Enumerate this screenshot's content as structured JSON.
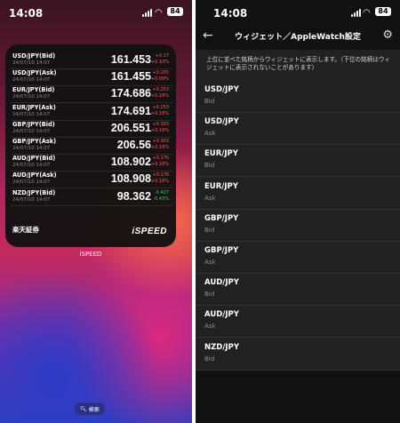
{
  "left_screen": {
    "status": {
      "time": "14:08",
      "battery": "84"
    },
    "widget": {
      "quotes": [
        {
          "pair": "USD/JPY(Bid)",
          "timestamp": "24/07/10 14:07",
          "price": "161.453",
          "change": "+0.17",
          "change_pct": "+0.10%",
          "direction": "up"
        },
        {
          "pair": "USD/JPY(Ask)",
          "timestamp": "24/07/10 14:07",
          "price": "161.455",
          "change": "+0.155",
          "change_pct": "+0.09%",
          "direction": "up"
        },
        {
          "pair": "EUR/JPY(Bid)",
          "timestamp": "24/07/10 14:07",
          "price": "174.686",
          "change": "+0.253",
          "change_pct": "+0.16%",
          "direction": "up"
        },
        {
          "pair": "EUR/JPY(Ask)",
          "timestamp": "24/07/10 14:07",
          "price": "174.691",
          "change": "+0.253",
          "change_pct": "+0.16%",
          "direction": "up"
        },
        {
          "pair": "GBP/JPY(Bid)",
          "timestamp": "24/07/10 14:07",
          "price": "206.551",
          "change": "+0.303",
          "change_pct": "+0.16%",
          "direction": "up"
        },
        {
          "pair": "GBP/JPY(Ask)",
          "timestamp": "24/07/10 14:07",
          "price": "206.56",
          "change": "+0.303",
          "change_pct": "+0.16%",
          "direction": "up"
        },
        {
          "pair": "AUD/JPY(Bid)",
          "timestamp": "24/07/10 14:07",
          "price": "108.902",
          "change": "+0.176",
          "change_pct": "+0.16%",
          "direction": "up"
        },
        {
          "pair": "AUD/JPY(Ask)",
          "timestamp": "24/07/10 14:07",
          "price": "108.908",
          "change": "+0.176",
          "change_pct": "+0.16%",
          "direction": "up"
        },
        {
          "pair": "NZD/JPY(Bid)",
          "timestamp": "24/07/10 14:07",
          "price": "98.362",
          "change": "-0.427",
          "change_pct": "-0.43%",
          "direction": "down"
        }
      ],
      "brand": "楽天証券",
      "logo": "iSPEED"
    },
    "widget_caption": "iSPEED",
    "search_label": "検索",
    "colors": {
      "up": "#ff5a5a",
      "down": "#3ad060"
    }
  },
  "right_screen": {
    "status": {
      "time": "14:08",
      "battery": "84"
    },
    "nav": {
      "title": "ウィジェット／AppleWatch設定"
    },
    "note": "上位に並べた銘柄からウィジェットに表示します。（下位の銘柄はウィジェットに表示されないことがあります）",
    "items": [
      {
        "symbol": "USD/JPY",
        "side": "Bid"
      },
      {
        "symbol": "USD/JPY",
        "side": "Ask"
      },
      {
        "symbol": "EUR/JPY",
        "side": "Bid"
      },
      {
        "symbol": "EUR/JPY",
        "side": "Ask"
      },
      {
        "symbol": "GBP/JPY",
        "side": "Bid"
      },
      {
        "symbol": "GBP/JPY",
        "side": "Ask"
      },
      {
        "symbol": "AUD/JPY",
        "side": "Bid"
      },
      {
        "symbol": "AUD/JPY",
        "side": "Ask"
      },
      {
        "symbol": "NZD/JPY",
        "side": "Bid"
      }
    ]
  }
}
